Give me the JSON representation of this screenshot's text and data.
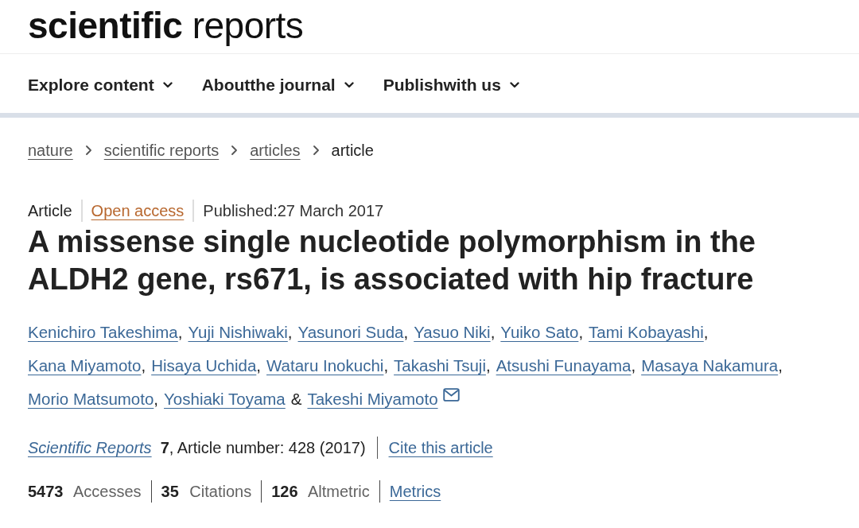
{
  "header": {
    "logo": "**scientific** reports"
  },
  "nav": {
    "items": [
      {
        "label": "Explore content"
      },
      {
        "label": "Aboutthe journal"
      },
      {
        "label": "Publishwith us"
      }
    ]
  },
  "breadcrumbs": [
    {
      "label": "nature",
      "kind": "link"
    },
    {
      "label": "scientific reports",
      "kind": "link"
    },
    {
      "label": "articles",
      "kind": "link"
    },
    {
      "label": "article",
      "kind": "current"
    }
  ],
  "article": {
    "type": "Article",
    "access": "Open access",
    "published": "Published:27 March 2017",
    "title": "A missense single nucleotide polymorphism in the ALDH2 gene, rs671, is associated with hip fracture",
    "authors": [
      {
        "name": "Kenichiro Takeshima",
        "corresponding": false,
        "separator": {
          "kind": "comma",
          "text": ","
        }
      },
      {
        "name": "Yuji Nishiwaki",
        "corresponding": false,
        "separator": {
          "kind": "comma",
          "text": ","
        }
      },
      {
        "name": "Yasunori Suda",
        "corresponding": false,
        "separator": {
          "kind": "comma",
          "text": ","
        }
      },
      {
        "name": "Yasuo Niki",
        "corresponding": false,
        "separator": {
          "kind": "comma",
          "text": ","
        }
      },
      {
        "name": "Yuiko Sato",
        "corresponding": false,
        "separator": {
          "kind": "comma",
          "text": ","
        }
      },
      {
        "name": "Tami Kobayashi",
        "corresponding": false,
        "separator": {
          "kind": "comma",
          "text": ","
        }
      },
      {
        "name": "Kana Miyamoto",
        "corresponding": false,
        "separator": {
          "kind": "comma",
          "text": ","
        }
      },
      {
        "name": "Hisaya Uchida",
        "corresponding": false,
        "separator": {
          "kind": "comma",
          "text": ","
        }
      },
      {
        "name": "Wataru Inokuchi",
        "corresponding": false,
        "separator": {
          "kind": "comma",
          "text": ","
        }
      },
      {
        "name": "Takashi Tsuji",
        "corresponding": false,
        "separator": {
          "kind": "comma",
          "text": ","
        }
      },
      {
        "name": "Atsushi Funayama",
        "corresponding": false,
        "separator": {
          "kind": "comma",
          "text": ","
        }
      },
      {
        "name": "Masaya Nakamura",
        "corresponding": false,
        "separator": {
          "kind": "comma",
          "text": ","
        }
      },
      {
        "name": "Morio Matsumoto",
        "corresponding": false,
        "separator": {
          "kind": "comma",
          "text": ","
        }
      },
      {
        "name": "Yoshiaki Toyama",
        "corresponding": false,
        "separator": {
          "kind": "conjunction",
          "text": "&"
        }
      },
      {
        "name": "Takeshi Miyamoto",
        "corresponding": true
      }
    ],
    "citation": {
      "journal": "Scientific Reports",
      "details": "**7**, Article number: 428 (2017)",
      "cite_link": "Cite this article"
    },
    "metrics": [
      "**5473** Accesses",
      "**35** Citations",
      "**126** Altmetric"
    ],
    "metrics_link": "Metrics"
  }
}
